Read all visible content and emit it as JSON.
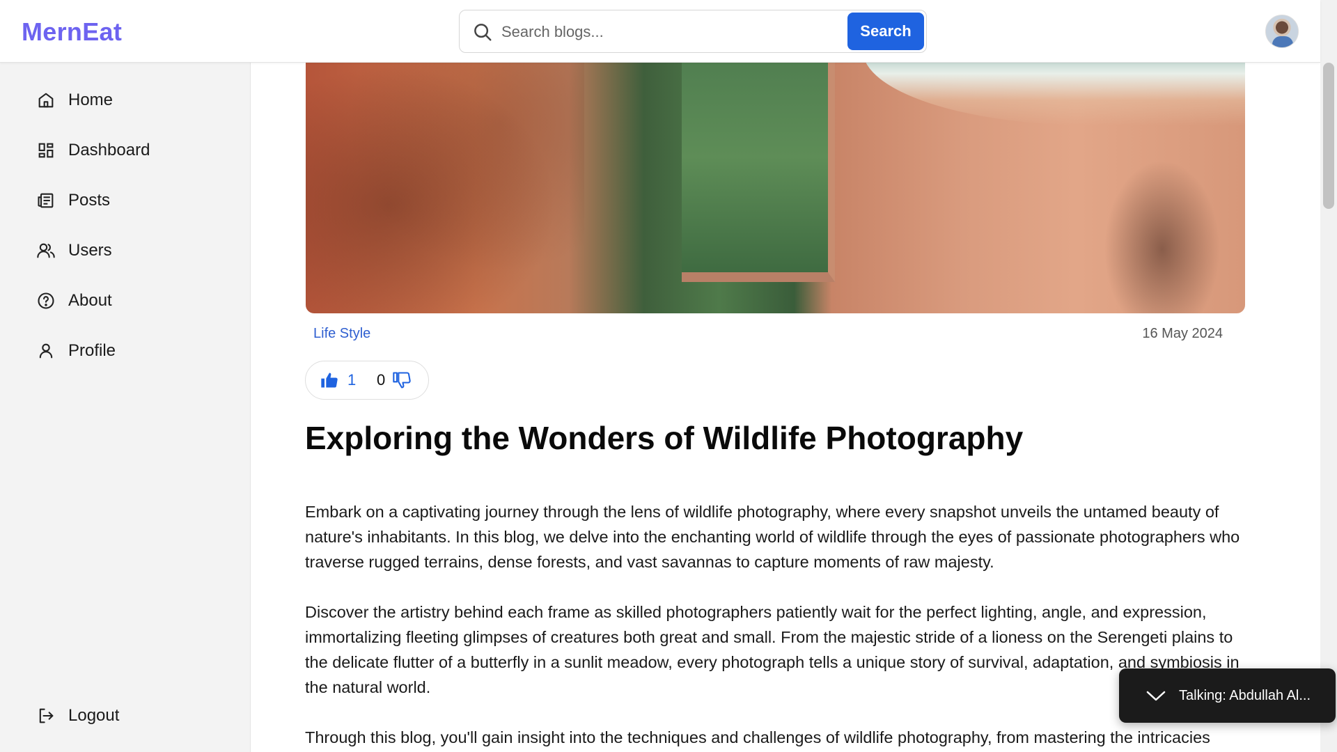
{
  "header": {
    "logo": "MernEat",
    "search": {
      "placeholder": "Search blogs...",
      "value": "",
      "button_label": "Search"
    }
  },
  "sidebar": {
    "items": [
      {
        "label": "Home",
        "icon": "home-icon"
      },
      {
        "label": "Dashboard",
        "icon": "dashboard-icon"
      },
      {
        "label": "Posts",
        "icon": "posts-icon"
      },
      {
        "label": "Users",
        "icon": "users-icon"
      },
      {
        "label": "About",
        "icon": "help-circle-icon"
      },
      {
        "label": "Profile",
        "icon": "user-icon"
      }
    ],
    "logout_label": "Logout"
  },
  "post": {
    "category": "Life Style",
    "date": "16 May 2024",
    "likes": "1",
    "dislikes": "0",
    "title": "Exploring the Wonders of Wildlife Photography",
    "paragraphs": [
      "Embark on a captivating journey through the lens of wildlife photography, where every snapshot unveils the untamed beauty of nature's inhabitants. In this blog, we delve into the enchanting world of wildlife through the eyes of passionate photographers who traverse rugged terrains, dense forests, and vast savannas to capture moments of raw majesty.",
      "Discover the artistry behind each frame as skilled photographers patiently wait for the perfect lighting, angle, and expression, immortalizing fleeting glimpses of creatures both great and small. From the majestic stride of a lioness on the Serengeti plains to the delicate flutter of a butterfly in a sunlit meadow, every photograph tells a unique story of survival, adaptation, and symbiosis in the natural world.",
      "Through this blog, you'll gain insight into the techniques and challenges of wildlife photography, from mastering the intricacies"
    ]
  },
  "toast": {
    "text": "Talking: Abdullah Al..."
  },
  "colors": {
    "brand": "#6d63f0",
    "primary": "#1f63e0",
    "link": "#2f5fd0"
  }
}
